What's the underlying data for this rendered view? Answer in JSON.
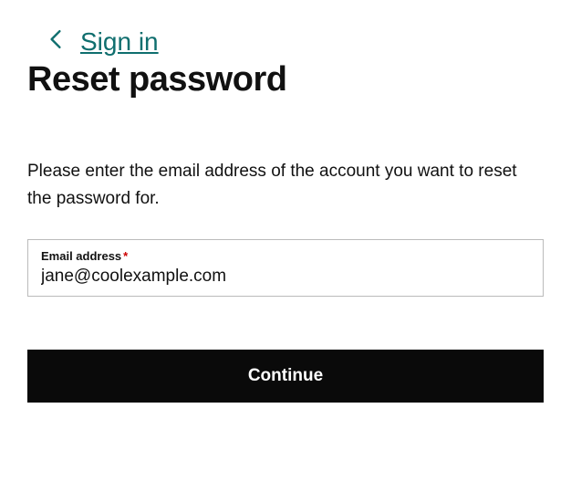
{
  "nav": {
    "back_link_label": "Sign in"
  },
  "page": {
    "title": "Reset password",
    "instruction": "Please enter the email address of the account you want to reset the password for."
  },
  "form": {
    "email": {
      "label": "Email address",
      "required_mark": "*",
      "value": "jane@coolexample.com"
    },
    "submit_label": "Continue"
  },
  "colors": {
    "accent": "#0f6e6e",
    "button_bg": "#0a0a0a",
    "error": "#c00"
  }
}
